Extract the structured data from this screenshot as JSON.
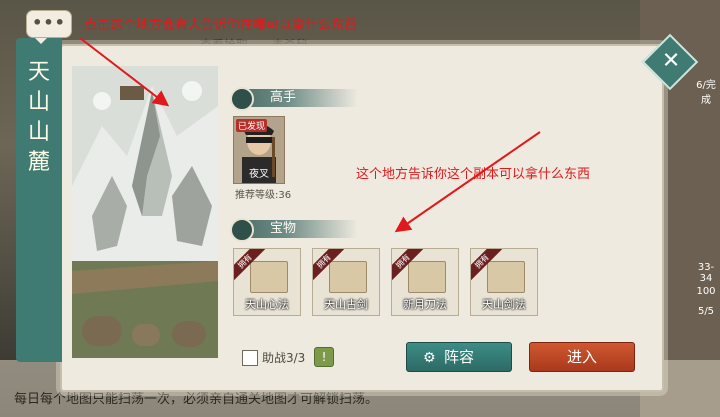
{
  "background": {
    "tabs": "查看拾取　　击杀秘",
    "bottom_text": "每日每个地图只能扫荡一次，必须亲自通关地图才可解锁扫荡。",
    "right_chips": [
      "6/完成",
      "33-34",
      "100",
      "5/5"
    ]
  },
  "chat_bubble": {
    "icon": "chat-dots-icon",
    "dots": "•••"
  },
  "annotations": {
    "top": "点击这个地方会有人告诉你在哪可以拿什么东西",
    "middle": "这个地方告诉你这个副本可以拿什么东西"
  },
  "dungeon": {
    "title_chars": [
      "天",
      "山",
      "山",
      "麓"
    ]
  },
  "close": {
    "glyph": "✕"
  },
  "sections": {
    "masters": "高手",
    "treasures": "宝物"
  },
  "hero": {
    "tag": "已发现",
    "name": "夜叉",
    "recommended_level": "推荐等级:36"
  },
  "items": [
    {
      "ribbon": "拥有",
      "name": "天山心法"
    },
    {
      "ribbon": "拥有",
      "name": "天山古剑"
    },
    {
      "ribbon": "拥有",
      "name": "新月刀法"
    },
    {
      "ribbon": "拥有",
      "name": "天山剑法"
    }
  ],
  "footer": {
    "assist_label": "助战3/3",
    "hint": "!",
    "formation_label": "阵容",
    "formation_icon": "formation-icon",
    "enter_label": "进入"
  },
  "colors": {
    "annotation": "#e0191c",
    "teal": "#3f7b72",
    "enter": "#c44b26"
  }
}
